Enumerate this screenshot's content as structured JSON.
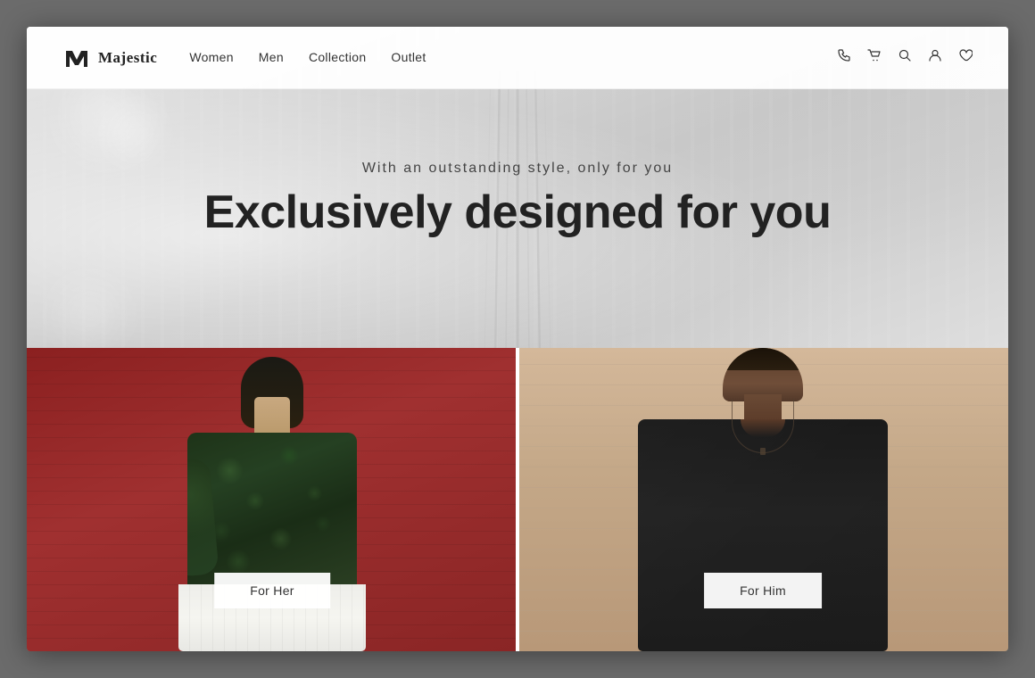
{
  "site": {
    "name": "Majestic",
    "logo_alt": "M logo"
  },
  "nav": {
    "links": [
      {
        "id": "women",
        "label": "Women"
      },
      {
        "id": "men",
        "label": "Men"
      },
      {
        "id": "collection",
        "label": "Collection"
      },
      {
        "id": "outlet",
        "label": "Outlet"
      }
    ],
    "icons": {
      "phone": "📞",
      "cart": "🛒",
      "search": "🔍",
      "user": "👤",
      "wishlist": "♡"
    }
  },
  "hero": {
    "subtitle": "With an outstanding style, only for you",
    "title": "Exclusively designed for you"
  },
  "cards": {
    "her": {
      "button_label": "For Her"
    },
    "him": {
      "button_label": "For Him"
    }
  }
}
